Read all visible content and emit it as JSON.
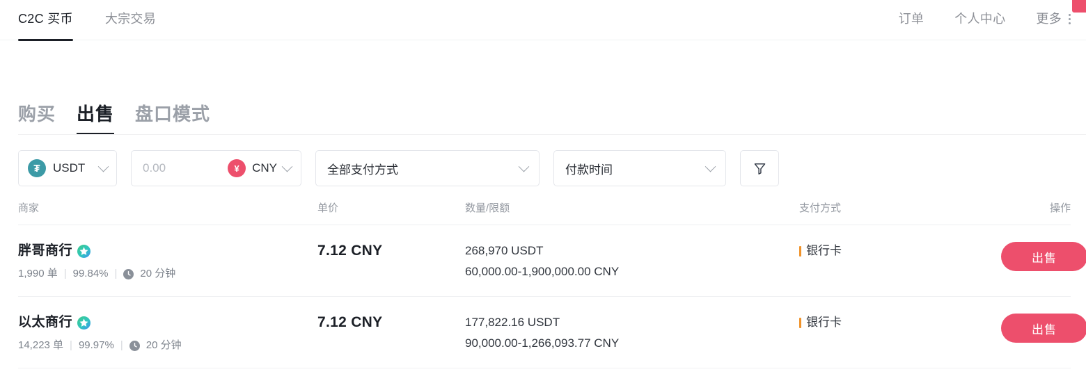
{
  "topnav": {
    "left_items": [
      {
        "label": "C2C 买币",
        "active": true
      },
      {
        "label": "大宗交易",
        "active": false
      }
    ],
    "right_items": [
      {
        "label": "订单"
      },
      {
        "label": "个人中心"
      }
    ],
    "more_label": "更多",
    "more_icon": "vertical-dots-icon",
    "corner_badge_color": "#ed4f6c"
  },
  "tabs": [
    {
      "label": "购买",
      "active": false
    },
    {
      "label": "出售",
      "active": true
    },
    {
      "label": "盘口模式",
      "active": false
    }
  ],
  "filters": {
    "coin": {
      "symbol": "USDT",
      "icon": "usdt-coin-icon",
      "icon_glyph": "₮",
      "icon_color": "#3c9aa6"
    },
    "amount": {
      "placeholder": "0.00",
      "value": ""
    },
    "fiat": {
      "symbol": "CNY",
      "icon": "cny-coin-icon",
      "icon_glyph": "¥",
      "icon_color": "#ed4f6c"
    },
    "payment_method": {
      "label": "全部支付方式"
    },
    "payment_time": {
      "label": "付款时间"
    },
    "filter_button": {
      "icon": "funnel-filter-icon"
    }
  },
  "table": {
    "headers": {
      "merchant": "商家",
      "price": "单价",
      "amount_limit": "数量/限额",
      "payment": "支付方式",
      "action": "操作"
    },
    "rows": [
      {
        "merchant": "胖哥商行",
        "verified": true,
        "orders": "1,990 单",
        "completion": "99.84%",
        "release_time": "20 分钟",
        "price": "7.12 CNY",
        "available": "268,970 USDT",
        "limit": "60,000.00-1,900,000.00 CNY",
        "payment": "银行卡",
        "action_label": "出售"
      },
      {
        "merchant": "以太商行",
        "verified": true,
        "orders": "14,223 单",
        "completion": "99.97%",
        "release_time": "20 分钟",
        "price": "7.12 CNY",
        "available": "177,822.16 USDT",
        "limit": "90,000.00-1,266,093.77 CNY",
        "payment": "银行卡",
        "action_label": "出售"
      }
    ],
    "separator": "|"
  },
  "colors": {
    "accent_sell": "#ed4f6c",
    "usdt_teal": "#3c9aa6",
    "payment_bar": "#f0932b",
    "text_primary": "#1b1f26",
    "text_muted": "#9499a1"
  }
}
